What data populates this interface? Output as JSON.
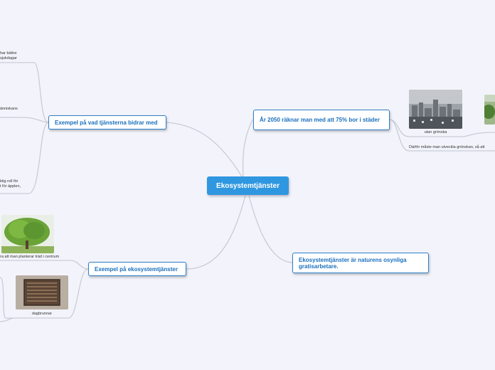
{
  "root": {
    "label": "Ekosystemtjänster"
  },
  "branches": {
    "urban": {
      "label": "År 2050 räknar man med att 75% bor i städer"
    },
    "contributes": {
      "label": "Exempel på vad tjänsterna bidrar med"
    },
    "examples": {
      "label": "Exempel på ekosystemtjänster"
    },
    "invisible": {
      "label": "Ekosystemtjänster är naturens osynliga gratisarbetare."
    }
  },
  "leaves": {
    "better": "har bättre",
    "sickdays": "sjukdagar",
    "humans": "änniskans",
    "role": "ktig roll för",
    "apples": "t för äpplen,",
    "without_green": "utan grönska",
    "develop": "Därför måste man utveckla grönskan, så att",
    "plant_trees": "ra att man planterar träd i centrum",
    "drain": "dagbrunnar"
  },
  "images": {
    "city": "city-skyline-image",
    "greencity": "green-city-image",
    "tree": "tree-image",
    "drain": "storm-drain-image"
  },
  "colors": {
    "background": "#f3f4fb",
    "accent": "#2e7fc8",
    "root": "#2f97e0",
    "line": "#c9ccd6"
  }
}
